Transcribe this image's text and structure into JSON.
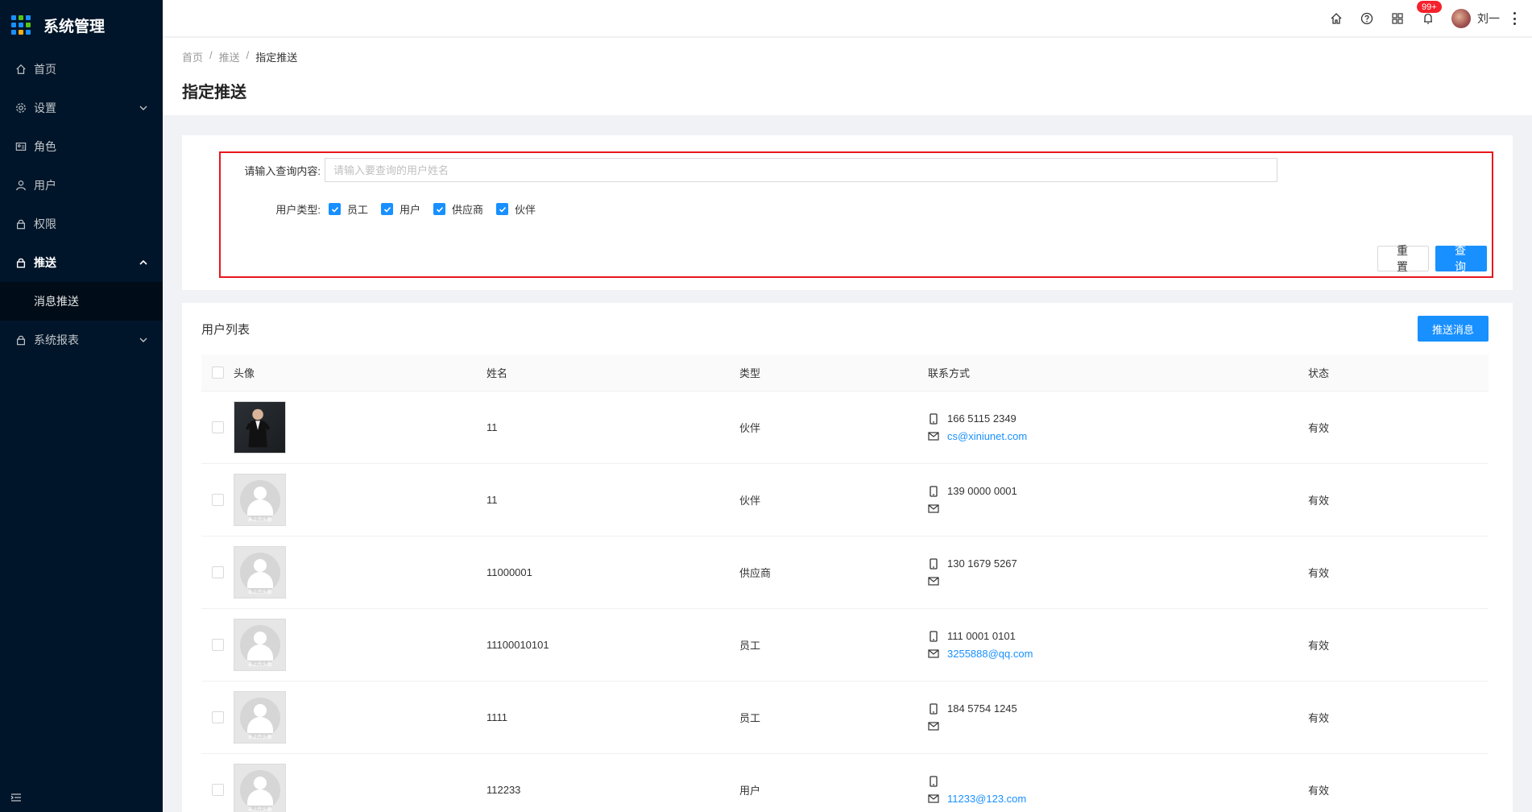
{
  "app": {
    "title": "系统管理"
  },
  "sidebar": {
    "items": [
      {
        "label": "首页",
        "icon": "home-icon"
      },
      {
        "label": "设置",
        "icon": "gear-icon"
      },
      {
        "label": "角色",
        "icon": "id-card-icon"
      },
      {
        "label": "用户",
        "icon": "user-icon"
      },
      {
        "label": "权限",
        "icon": "lock-icon"
      },
      {
        "label": "推送",
        "icon": "lock-icon"
      },
      {
        "label": "系统报表",
        "icon": "lock-icon"
      }
    ],
    "submenu": {
      "label": "消息推送"
    }
  },
  "header": {
    "notification_count": "99+",
    "user_name": "刘一"
  },
  "breadcrumb": {
    "items": [
      "首页",
      "推送",
      "指定推送"
    ]
  },
  "page": {
    "title": "指定推送"
  },
  "search": {
    "query_label": "请输入查询内容:",
    "query_value": "",
    "query_placeholder": "请输入要查询的用户姓名",
    "type_label": "用户类型:",
    "types": [
      {
        "label": "员工",
        "checked": true
      },
      {
        "label": "用户",
        "checked": true
      },
      {
        "label": "供应商",
        "checked": true
      },
      {
        "label": "伙伴",
        "checked": true
      }
    ],
    "reset_label": "重 置",
    "submit_label": "查 询"
  },
  "table": {
    "title": "用户列表",
    "action_label": "推送消息",
    "columns": [
      "头像",
      "姓名",
      "类型",
      "联系方式",
      "状态"
    ],
    "placeholder_photo_text": "未上传头像",
    "rows": [
      {
        "photo": "uploaded",
        "name": "11",
        "type": "伙伴",
        "phone": "166 5115 2349",
        "email": "cs@xiniunet.com",
        "status": "有效"
      },
      {
        "photo": "default",
        "name": "11",
        "type": "伙伴",
        "phone": "139 0000 0001",
        "email": "",
        "status": "有效"
      },
      {
        "photo": "default",
        "name": "11000001",
        "type": "供应商",
        "phone": "130 1679 5267",
        "email": "",
        "status": "有效"
      },
      {
        "photo": "default",
        "name": "11100010101",
        "type": "员工",
        "phone": "111 0001 0101",
        "email": "3255888@qq.com",
        "status": "有效"
      },
      {
        "photo": "default",
        "name": "1111",
        "type": "员工",
        "phone": "184 5754 1245",
        "email": "",
        "status": "有效"
      },
      {
        "photo": "default",
        "name": "112233",
        "type": "用户",
        "phone": "",
        "email": "11233@123.com",
        "status": "有效"
      }
    ]
  },
  "colors": {
    "sidebar_bg": "#001529",
    "primary": "#1890ff",
    "highlight_border": "#e8161d",
    "badge": "#f5222d"
  }
}
